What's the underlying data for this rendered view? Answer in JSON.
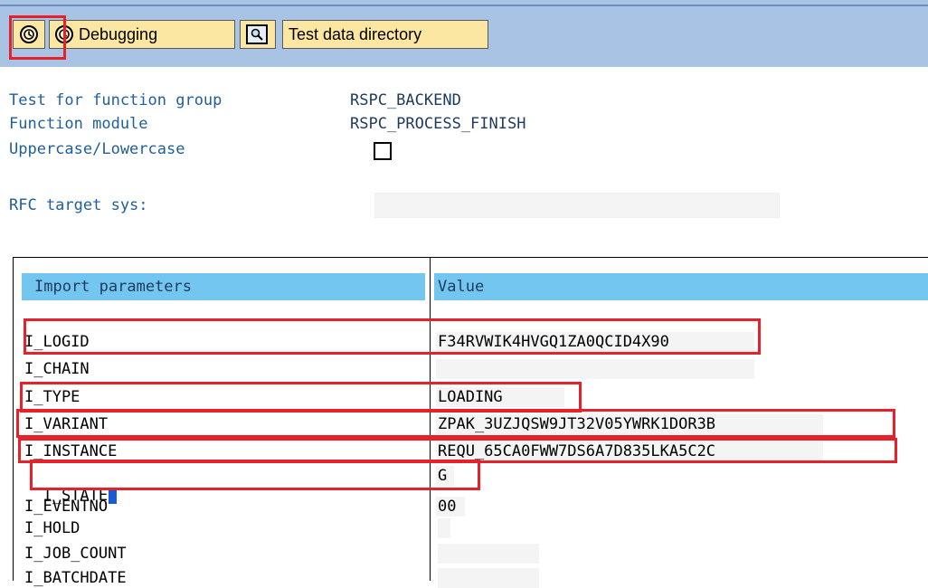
{
  "toolbar": {
    "execute_icon": "execute-icon",
    "debugging_label": "Debugging",
    "test_data_directory_label": "Test data directory"
  },
  "header": {
    "test_group_label": "Test for function group",
    "test_group_value": "RSPC_BACKEND",
    "function_module_label": "Function module",
    "function_module_value": "RSPC_PROCESS_FINISH",
    "case_label": "Uppercase/Lowercase",
    "rfc_label": "RFC target sys:",
    "rfc_value": ""
  },
  "params": {
    "col_param": "Import parameters",
    "col_value": "Value",
    "rows": [
      {
        "name": "I_LOGID",
        "value": "F34RVWIK4HVGQ1ZA0QCID4X90"
      },
      {
        "name": "I_CHAIN",
        "value": ""
      },
      {
        "name": "I_TYPE",
        "value": "LOADING"
      },
      {
        "name": "I_VARIANT",
        "value": "ZPAK_3UZJQSW9JT32V05YWRK1DOR3B"
      },
      {
        "name": "I_INSTANCE",
        "value": "REQU_65CA0FWW7DS6A7D835LKA5C2C"
      },
      {
        "name": "I_STATE",
        "value": "G"
      },
      {
        "name": "I_EVENTNO",
        "value": "00"
      },
      {
        "name": "I_HOLD",
        "value": ""
      },
      {
        "name": "I_JOB_COUNT",
        "value": ""
      },
      {
        "name": "I_BATCHDATE",
        "value": ""
      }
    ]
  },
  "colors": {
    "toolbar_bg": "#a9c3e5",
    "button_bg": "#fbe7a2",
    "highlight": "#e8202a",
    "header_bg": "#73c6f0",
    "label_text": "#1f5f9a"
  }
}
